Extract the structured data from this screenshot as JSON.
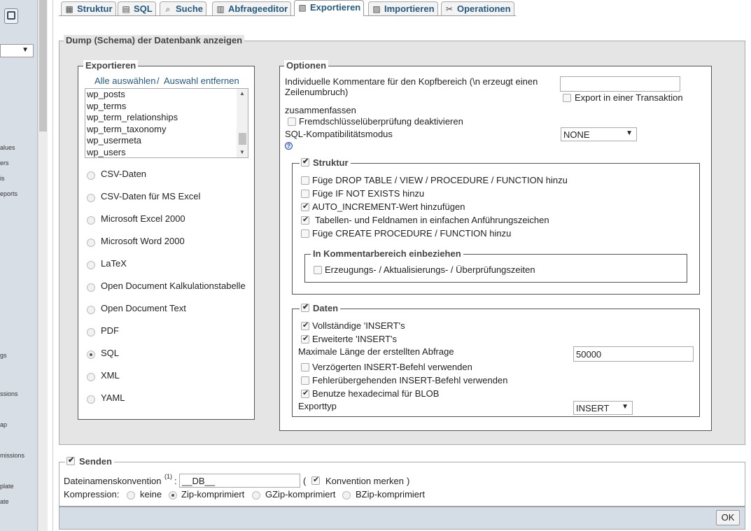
{
  "nav": {
    "items": [
      "alues",
      "ers",
      "is",
      "eports",
      "gs",
      "ssions",
      "ap",
      "missions",
      "plate",
      "ate"
    ]
  },
  "tabs": [
    {
      "label": "Struktur",
      "icon": "structure-icon",
      "glyph": "▦"
    },
    {
      "label": "SQL",
      "icon": "sql-icon",
      "glyph": "▤"
    },
    {
      "label": "Suche",
      "icon": "search-icon",
      "glyph": "⌕"
    },
    {
      "label": "Abfrageeditor",
      "icon": "query-icon",
      "glyph": "▥"
    },
    {
      "label": "Exportieren",
      "icon": "export-icon",
      "glyph": "▧"
    },
    {
      "label": "Importieren",
      "icon": "import-icon",
      "glyph": "▨"
    },
    {
      "label": "Operationen",
      "icon": "operations-icon",
      "glyph": "✂"
    }
  ],
  "page": {
    "title": "Dump (Schema) der Datenbank anzeigen"
  },
  "export": {
    "legend": "Exportieren",
    "select_all": "Alle auswählen",
    "separator": "/",
    "deselect_all": "Auswahl entfernen",
    "tables": [
      "wp_posts",
      "wp_terms",
      "wp_term_relationships",
      "wp_term_taxonomy",
      "wp_usermeta",
      "wp_users"
    ],
    "formats": [
      "CSV-Daten",
      "CSV-Daten für MS Excel",
      "Microsoft Excel 2000",
      "Microsoft Word 2000",
      "LaTeX",
      "Open Document Kalkulationstabelle",
      "Open Document Text",
      "PDF",
      "SQL",
      "XML",
      "YAML"
    ],
    "selected_format": "SQL"
  },
  "options": {
    "legend": "Optionen",
    "comments_label": "Individuelle Kommentare für den Kopfbereich (\\n erzeugt einen Zeilenumbruch)",
    "comments_value": "",
    "transaction_label": "Export in einer Transaktion",
    "zusammenfassen": "zusammenfassen",
    "fk_label": "Fremdschlüsselüberprüfung deaktivieren",
    "compat_label": "SQL-Kompatibilitätsmodus",
    "compat_value": "NONE",
    "structure": {
      "legend": "Struktur",
      "items": [
        {
          "label": "Füge DROP TABLE / VIEW / PROCEDURE / FUNCTION hinzu",
          "checked": false
        },
        {
          "label": "Füge IF NOT EXISTS hinzu",
          "checked": false
        },
        {
          "label": "AUTO_INCREMENT-Wert hinzufügen",
          "checked": true
        },
        {
          "label": "Tabellen- und Feldnamen in einfachen Anführungszeichen",
          "checked": true
        },
        {
          "label": "Füge CREATE PROCEDURE / FUNCTION hinzu",
          "checked": false
        }
      ],
      "comment_legend": "In Kommentarbereich einbeziehen",
      "comment_item": "Erzeugungs- / Aktualisierungs- / Überprüfungszeiten"
    },
    "data": {
      "legend": "Daten",
      "complete_insert": "Vollständige 'INSERT's",
      "extended_insert": "Erweiterte 'INSERT's",
      "max_length_label": "Maximale Länge der erstellten Abfrage",
      "max_length_value": "50000",
      "delayed": "Verzögerten INSERT-Befehl verwenden",
      "ignore": "Fehlerübergehenden INSERT-Befehl verwenden",
      "hex": "Benutze hexadecimal für BLOB",
      "type_label": "Exporttyp",
      "type_value": "INSERT"
    }
  },
  "send": {
    "legend": "Senden",
    "filename_label": "Dateinamenskonvention",
    "footnote": "(1)",
    "colon": ":",
    "filename_value": "__DB__",
    "paren_open": "(",
    "remember_label": "Konvention merken",
    "paren_close": ")",
    "compression_label": "Kompression:",
    "compressions": [
      "keine",
      "Zip-komprimiert",
      "GZip-komprimiert",
      "BZip-komprimiert"
    ],
    "ok_label": "OK"
  }
}
